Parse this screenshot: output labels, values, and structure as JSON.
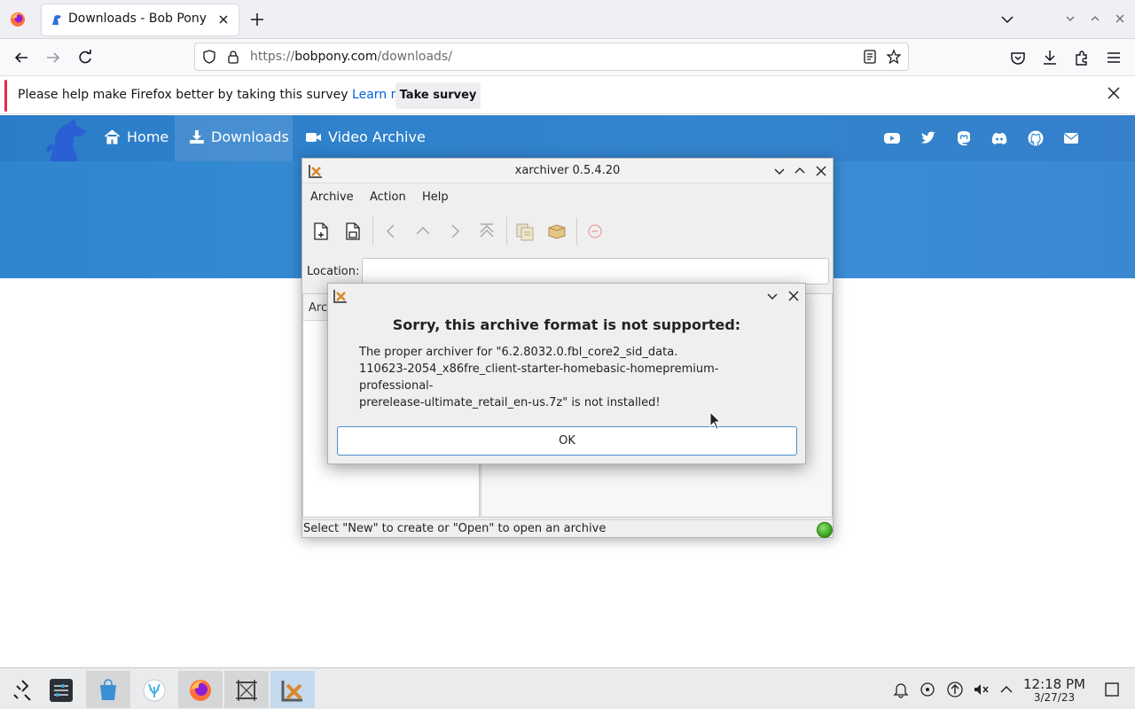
{
  "browser": {
    "tab_title": "Downloads - Bob Pony",
    "url_prefix": "https://",
    "url_host": "bobpony.com",
    "url_path": "/downloads/",
    "survey_text": "Please help make Firefox better by taking this survey",
    "survey_link": "Learn more",
    "survey_button": "Take survey"
  },
  "site": {
    "nav": [
      "Home",
      "Downloads",
      "Video Archive"
    ],
    "social_icons": [
      "youtube-icon",
      "twitter-icon",
      "mastodon-icon",
      "discord-icon",
      "github-icon",
      "mail-icon"
    ],
    "hero_color": "#3a8fd6"
  },
  "xarchiver": {
    "title": "xarchiver 0.5.4.20",
    "menu": [
      "Archive",
      "Action",
      "Help"
    ],
    "location_label": "Location:",
    "location_value": "",
    "left_pane_header": "Arc",
    "status": "Select \"New\" to create or \"Open\" to open an archive"
  },
  "dialog": {
    "heading": "Sorry, this archive format is not supported:",
    "body": "The proper archiver for \"6.2.8032.0.fbl_core2_sid_data.\n110623-2054_x86fre_client-starter-homebasic-homepremium-professional-\nprerelease-ultimate_retail_en-us.7z\" is not installed!",
    "ok": "OK"
  },
  "taskbar": {
    "time": "12:18 PM",
    "date": "3/27/23"
  }
}
